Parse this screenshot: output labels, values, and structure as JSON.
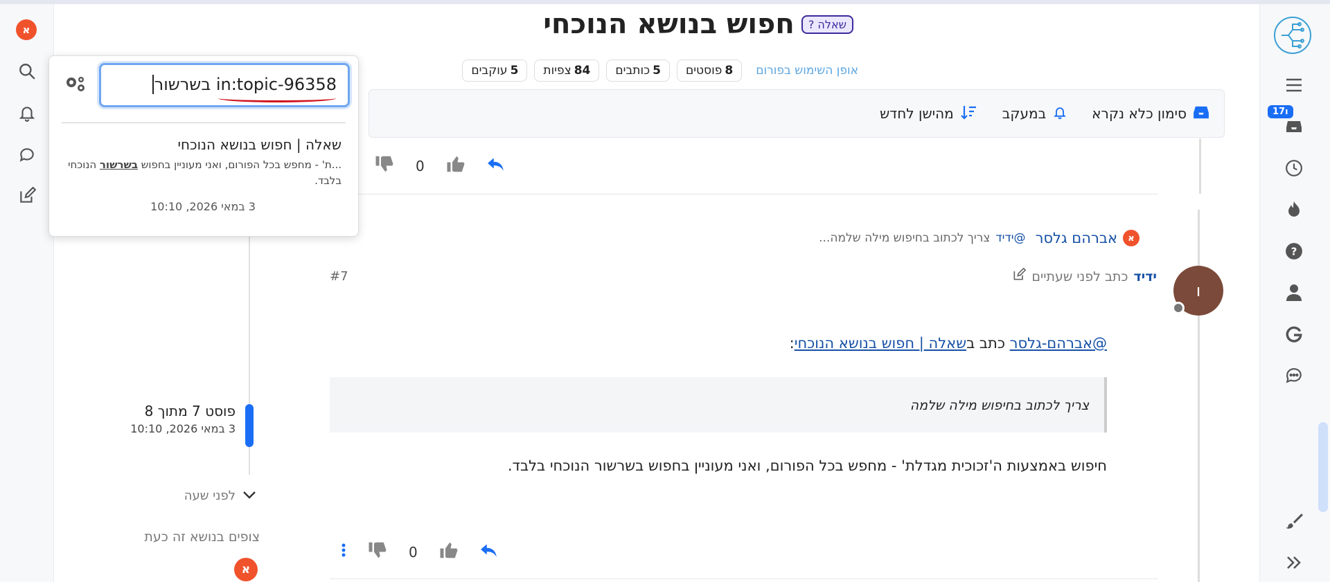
{
  "topic": {
    "badge": "שאלה ?",
    "title": "חפוש בנושא הנוכחי"
  },
  "stats": {
    "usage_link": "אופן השימוש בפורום",
    "posts_count": "8",
    "posts_label": "פוסטים",
    "writers_count": "5",
    "writers_label": "כותבים",
    "views_count": "84",
    "views_label": "צפיות",
    "followers_count": "5",
    "followers_label": "עוקבים"
  },
  "toolbar": {
    "mark_read": "סימון כלא נקרא",
    "tracking": "במעקב",
    "sort": "מהישן לחדש"
  },
  "post_prev": {
    "votes": "0"
  },
  "reply_ref": {
    "author_initial": "א",
    "author": "אברהם גלסר",
    "mention": "@ידיד",
    "excerpt": "צריך לכתוב בחיפוש מילה שלמה..."
  },
  "post": {
    "avatar_letter": "ו",
    "author": "ידיד",
    "meta": "כתב לפני שעתיים",
    "index": "#7",
    "mention_user": "@אברהם-גלסר",
    "wrote_in": "כתב ב",
    "topic_link": "שאלה | חפוש בנושא הנוכחי",
    "colon": ":",
    "quote": "צריך לכתוב בחיפוש מילה שלמה",
    "body": "חיפוש באמצעות ה'זכוכית מגדלת' - מחפש בכל הפורום, ואני מעוניין בחפוש בשרשור הנוכחי בלבד.",
    "votes": "0"
  },
  "timeline": {
    "position": "פוסט 7 מתוך 8",
    "date": "3 במאי 2026, 10:10",
    "ago": "לפני שעה",
    "watching": "צופים בנושא זה כעת",
    "watcher_initial": "א",
    "progress": 0.875
  },
  "search": {
    "query_prefix": "in:topic-96358",
    "query_rest": " בשרשור",
    "result_title": "שאלה | חפוש בנושא הנוכחי",
    "snippet_before": "...ת' - מחפש בכל הפורום, ואני מעוניין בחפוש ",
    "snippet_match": "בשרשור",
    "snippet_after": " הנוכחי בלבד.",
    "result_date": "3 במאי 2026, 10:10"
  },
  "nav": {
    "user_initial": "א",
    "inbox_badge": "17ו"
  },
  "colors": {
    "accent": "#1a6ef5",
    "avatar_orange": "#f0522c",
    "avatar_brown": "#7b4a3a",
    "link_blue": "#1650a6"
  }
}
